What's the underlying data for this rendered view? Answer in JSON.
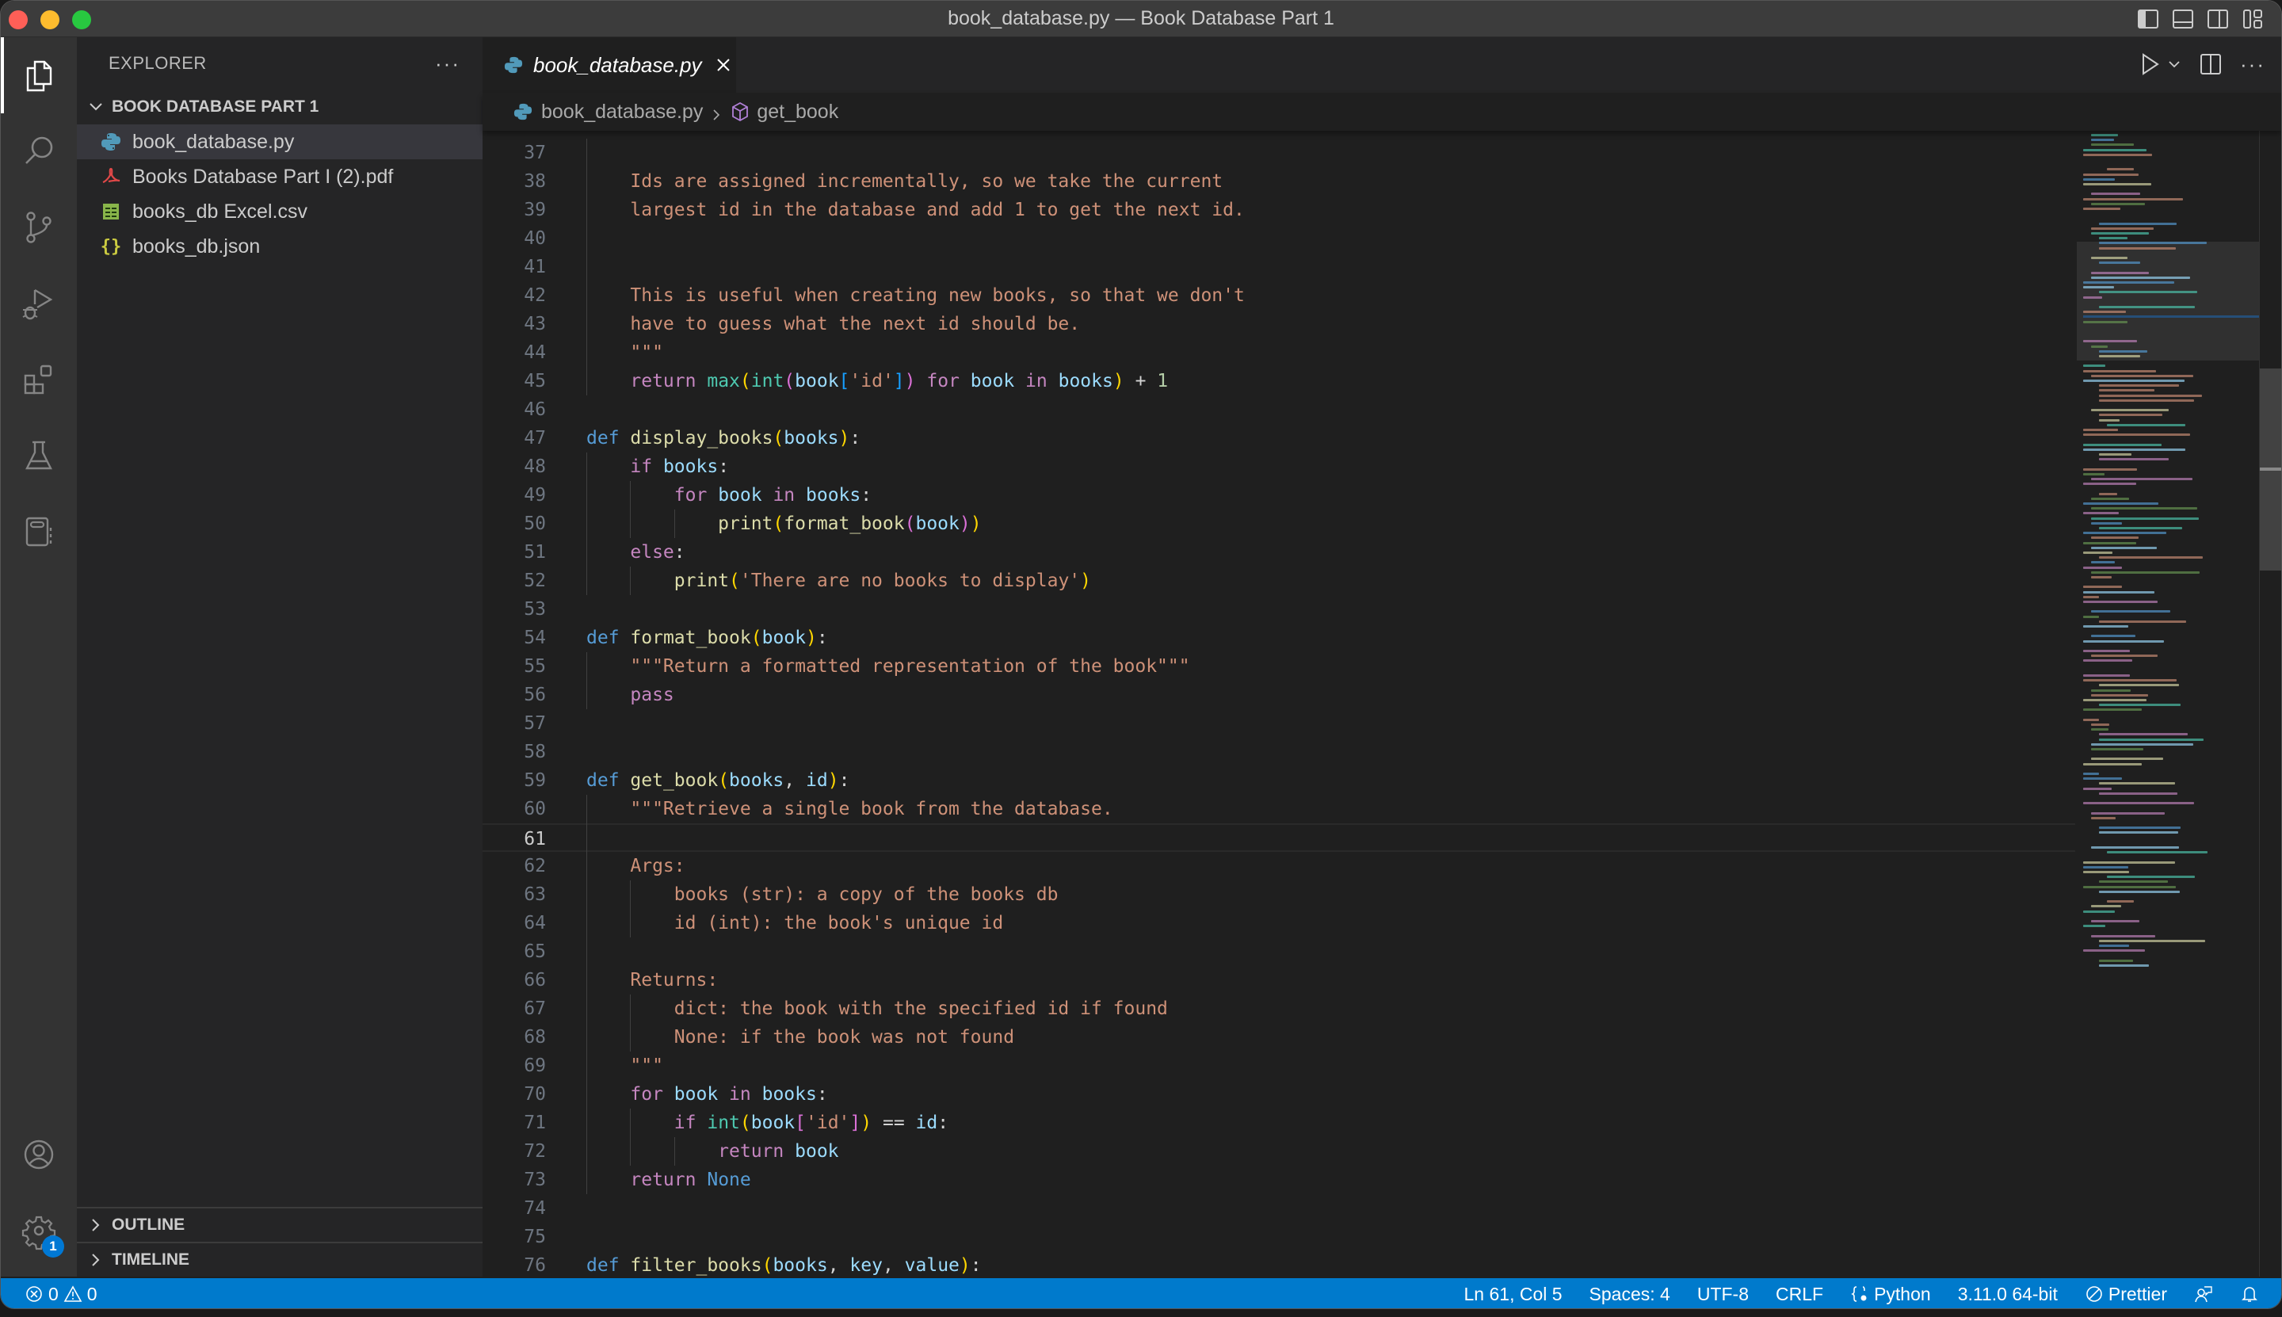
{
  "window": {
    "title": "book_database.py — Book Database Part 1"
  },
  "activity_bar": {
    "items": [
      {
        "name": "explorer",
        "icon": "files-icon",
        "active": true
      },
      {
        "name": "search",
        "icon": "search-icon"
      },
      {
        "name": "source-control",
        "icon": "source-control-icon"
      },
      {
        "name": "run-and-debug",
        "icon": "run-debug-icon"
      },
      {
        "name": "extensions",
        "icon": "extensions-icon"
      },
      {
        "name": "testing",
        "icon": "beaker-icon"
      },
      {
        "name": "notebook",
        "icon": "notebook-icon"
      }
    ],
    "accounts_icon": "account-icon",
    "settings_icon": "gear-icon",
    "settings_badge": "1"
  },
  "sidebar": {
    "header": "EXPLORER",
    "more": "···",
    "folder": "BOOK DATABASE PART 1",
    "files": [
      {
        "name": "book_database.py",
        "icon": "python-icon",
        "selected": true
      },
      {
        "name": "Books Database Part I (2).pdf",
        "icon": "pdf-icon"
      },
      {
        "name": "books_db Excel.csv",
        "icon": "csv-icon"
      },
      {
        "name": "books_db.json",
        "icon": "json-icon"
      }
    ],
    "sections": [
      "OUTLINE",
      "TIMELINE"
    ]
  },
  "editor": {
    "tab": {
      "label": "book_database.py",
      "icon": "python-icon"
    },
    "breadcrumb": {
      "file": "book_database.py",
      "symbol": "get_book"
    },
    "current_line": 61,
    "lines": [
      {
        "n": 37,
        "t": ""
      },
      {
        "n": 38,
        "t": "    Ids are assigned incrementally, so we take the current"
      },
      {
        "n": 39,
        "t": "    largest id in the database and add 1 to get the next id."
      },
      {
        "n": 40,
        "t": ""
      },
      {
        "n": 41,
        "t": ""
      },
      {
        "n": 42,
        "t": "    This is useful when creating new books, so that we don't"
      },
      {
        "n": 43,
        "t": "    have to guess what the next id should be."
      },
      {
        "n": 44,
        "t": "    \"\"\""
      },
      {
        "n": 45,
        "t": "    return max(int(book['id']) for book in books) + 1"
      },
      {
        "n": 46,
        "t": ""
      },
      {
        "n": 47,
        "t": "def display_books(books):"
      },
      {
        "n": 48,
        "t": "    if books:"
      },
      {
        "n": 49,
        "t": "        for book in books:"
      },
      {
        "n": 50,
        "t": "            print(format_book(book))"
      },
      {
        "n": 51,
        "t": "    else:"
      },
      {
        "n": 52,
        "t": "        print('There are no books to display')"
      },
      {
        "n": 53,
        "t": ""
      },
      {
        "n": 54,
        "t": "def format_book(book):"
      },
      {
        "n": 55,
        "t": "    \"\"\"Return a formatted representation of the book\"\"\""
      },
      {
        "n": 56,
        "t": "    pass"
      },
      {
        "n": 57,
        "t": ""
      },
      {
        "n": 58,
        "t": ""
      },
      {
        "n": 59,
        "t": "def get_book(books, id):"
      },
      {
        "n": 60,
        "t": "    \"\"\"Retrieve a single book from the database."
      },
      {
        "n": 61,
        "t": ""
      },
      {
        "n": 62,
        "t": "    Args:"
      },
      {
        "n": 63,
        "t": "        books (str): a copy of the books db"
      },
      {
        "n": 64,
        "t": "        id (int): the book's unique id"
      },
      {
        "n": 65,
        "t": ""
      },
      {
        "n": 66,
        "t": "    Returns:"
      },
      {
        "n": 67,
        "t": "        dict: the book with the specified id if found"
      },
      {
        "n": 68,
        "t": "        None: if the book was not found"
      },
      {
        "n": 69,
        "t": "    \"\"\""
      },
      {
        "n": 70,
        "t": "    for book in books:"
      },
      {
        "n": 71,
        "t": "        if int(book['id']) == id:"
      },
      {
        "n": 72,
        "t": "            return book"
      },
      {
        "n": 73,
        "t": "    return None"
      },
      {
        "n": 74,
        "t": ""
      },
      {
        "n": 75,
        "t": ""
      },
      {
        "n": 76,
        "t": "def filter_books(books, key, value):"
      }
    ]
  },
  "status_bar": {
    "errors": "0",
    "warnings": "0",
    "position": "Ln 61, Col 5",
    "spaces": "Spaces: 4",
    "encoding": "UTF-8",
    "eol": "CRLF",
    "language": "Python",
    "interpreter": "3.11.0 64-bit",
    "formatter": "Prettier"
  },
  "colors": {
    "accent": "#007acc",
    "string": "#ce9178",
    "keyword_def": "#569cd6",
    "keyword_control": "#c586c0",
    "function": "#dcdcaa",
    "builtin": "#4ec9b0",
    "variable": "#9cdcfe"
  }
}
